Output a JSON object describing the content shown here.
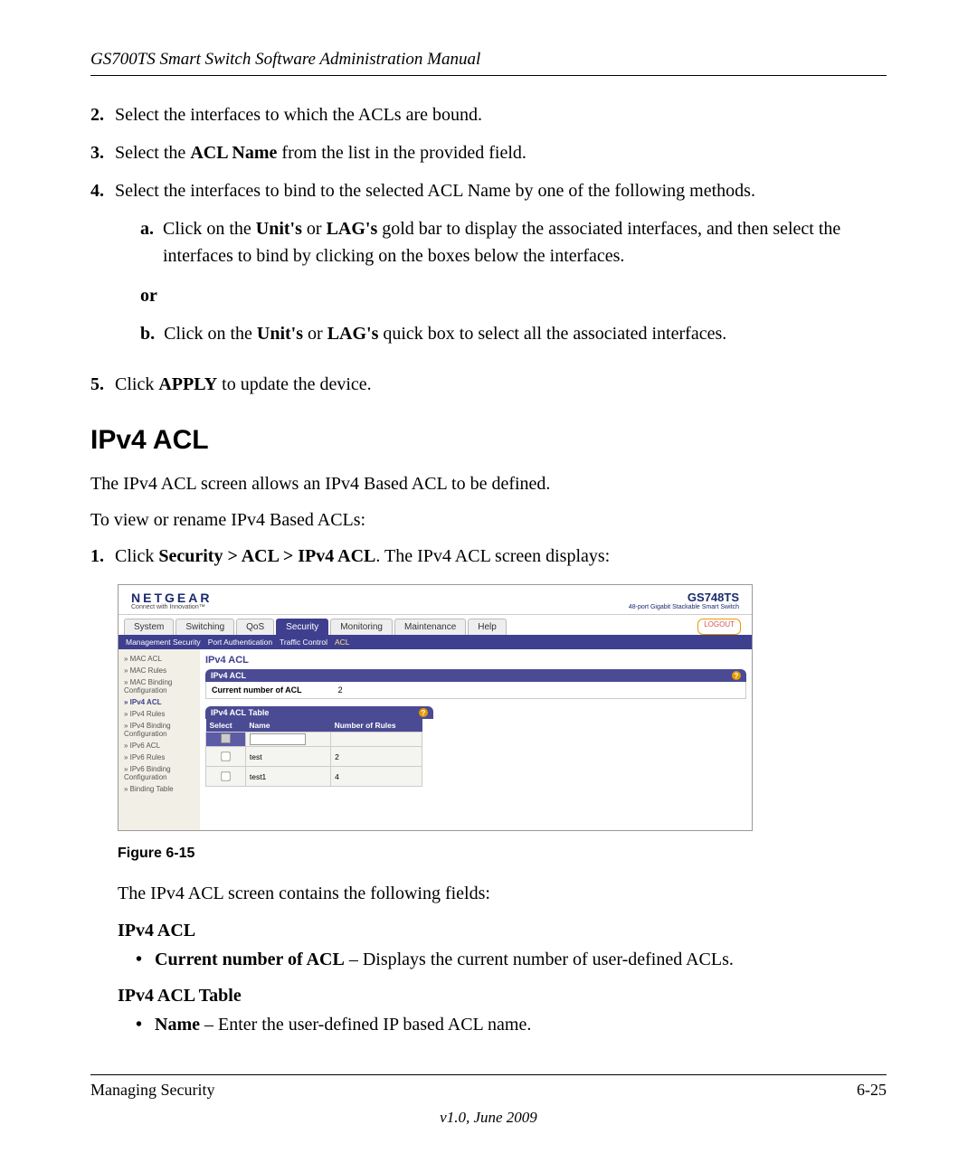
{
  "header": "GS700TS Smart Switch Software Administration Manual",
  "steps": {
    "s2": "Select the interfaces to which the ACLs are bound.",
    "s3_pre": "Select the ",
    "s3_bold": "ACL Name",
    "s3_post": " from the list in the provided field.",
    "s4": "Select the interfaces to bind to the selected ACL Name by one of the following methods.",
    "s4a_pre": "Click on the ",
    "s4a_b1": "Unit's",
    "s4a_mid1": " or ",
    "s4a_b2": "LAG's",
    "s4a_post": " gold bar to display the associated interfaces, and then select the interfaces to bind by clicking on the boxes below the interfaces.",
    "or": "or",
    "s4b_pre": "Click on the ",
    "s4b_b1": "Unit's",
    "s4b_mid1": " or ",
    "s4b_b2": "LAG's",
    "s4b_post": " quick box to select all the associated interfaces.",
    "s5_pre": "Click ",
    "s5_bold": "APPLY",
    "s5_post": " to update the device."
  },
  "section_title": "IPv4 ACL",
  "section_p1": "The IPv4 ACL screen allows an IPv4 Based ACL to be defined.",
  "section_p2": "To view or rename IPv4 Based ACLs:",
  "step1_pre": "Click ",
  "step1_bold": "Security > ACL > IPv4 ACL",
  "step1_post": ". The IPv4 ACL screen displays:",
  "figure": {
    "brand": "NETGEAR",
    "brand_tag": "Connect with Innovation™",
    "model": "GS748TS",
    "model_sub": "48-port Gigabit Stackable Smart Switch",
    "tabs": [
      "System",
      "Switching",
      "QoS",
      "Security",
      "Monitoring",
      "Maintenance",
      "Help"
    ],
    "active_tab": "Security",
    "logout": "LOGOUT",
    "subnav": [
      "Management Security",
      "Port Authentication",
      "Traffic Control",
      "ACL"
    ],
    "subnav_active": "ACL",
    "side_items": [
      "» MAC ACL",
      "» MAC Rules",
      "» MAC Binding Configuration",
      "» IPv4 ACL",
      "» IPv4 Rules",
      "» IPv4 Binding Configuration",
      "» IPv6 ACL",
      "» IPv6 Rules",
      "» IPv6 Binding Configuration",
      "» Binding Table"
    ],
    "side_active_index": 3,
    "content_title": "IPv4 ACL",
    "panel1_title": "IPv4 ACL",
    "panel1_label": "Current number of ACL",
    "panel1_value": "2",
    "panel2_title": "IPv4 ACL Table",
    "table_headers": [
      "Select",
      "Name",
      "Number of Rules"
    ],
    "rows": [
      {
        "name": "test",
        "rules": "2"
      },
      {
        "name": "test1",
        "rules": "4"
      }
    ]
  },
  "fig_caption": "Figure 6-15",
  "after_fig": "The IPv4 ACL screen contains the following fields:",
  "fields": {
    "h1": "IPv4 ACL",
    "b1_bold": "Current number of ACL",
    "b1_rest": " – Displays the current number of user-defined ACLs.",
    "h2": "IPv4 ACL Table",
    "b2_bold": "Name",
    "b2_rest": " – Enter the user-defined IP based ACL name."
  },
  "footer": {
    "left": "Managing Security",
    "right": "6-25",
    "version": "v1.0, June 2009"
  }
}
